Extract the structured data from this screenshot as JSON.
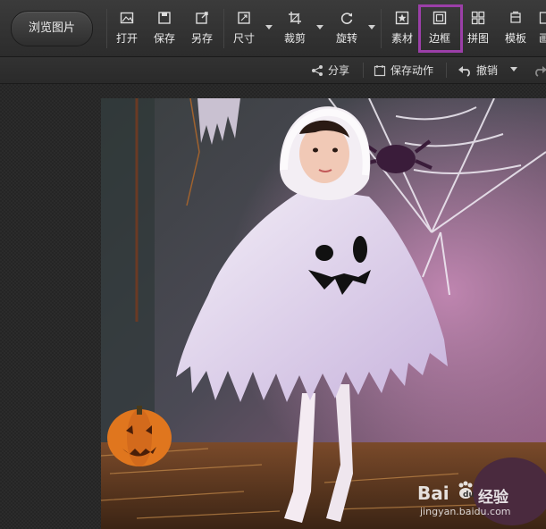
{
  "toolbar": {
    "browse_label": "浏览图片",
    "tools": [
      {
        "label": "打开",
        "icon": "open-image-icon"
      },
      {
        "label": "保存",
        "icon": "save-icon"
      },
      {
        "label": "另存",
        "icon": "save-as-icon"
      },
      {
        "label": "尺寸",
        "icon": "resize-icon"
      },
      {
        "label": "裁剪",
        "icon": "crop-icon"
      },
      {
        "label": "旋转",
        "icon": "rotate-icon"
      },
      {
        "label": "素材",
        "icon": "sticker-icon"
      },
      {
        "label": "边框",
        "icon": "border-frame-icon"
      },
      {
        "label": "拼图",
        "icon": "collage-icon"
      },
      {
        "label": "模板",
        "icon": "template-icon"
      },
      {
        "label": "画",
        "icon": "draw-icon"
      }
    ],
    "active_tool": "边框",
    "highlight_color": "#9b3fa8"
  },
  "subbar": {
    "share_label": "分享",
    "save_action_label": "保存动作",
    "undo_label": "撤销"
  },
  "watermark": {
    "brand": "Bai",
    "brand_cn": "经验",
    "url": "jingyan.baidu.com"
  }
}
